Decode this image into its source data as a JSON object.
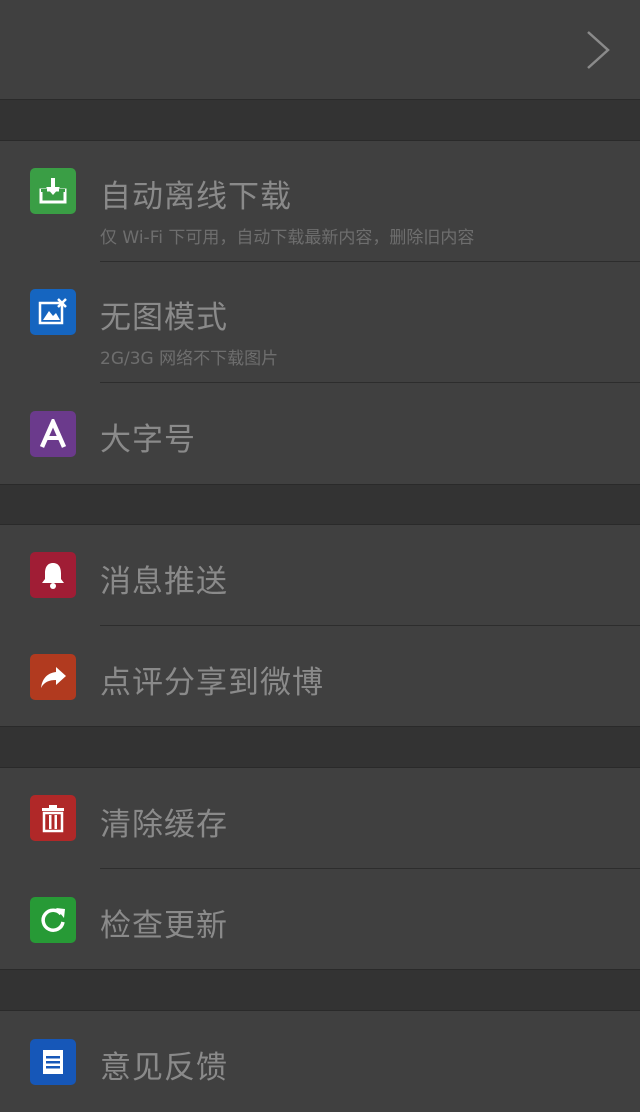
{
  "header": {
    "chevron_icon": "chevron-right-icon"
  },
  "colors": {
    "background": "#333333",
    "panel": "#404040",
    "label_text": "#8a8a8a",
    "sub_text": "#6e6e6e"
  },
  "groups": [
    {
      "items": [
        {
          "label": "自动离线下载",
          "sub": "仅 Wi-Fi 下可用，自动下载最新内容，删除旧内容",
          "icon": "download-icon",
          "color": "#3a9e45"
        },
        {
          "label": "无图模式",
          "sub": "2G/3G 网络不下载图片",
          "icon": "no-image-icon",
          "color": "#1565c0"
        },
        {
          "label": "大字号",
          "icon": "font-size-icon",
          "color": "#6b3a8c"
        }
      ]
    },
    {
      "items": [
        {
          "label": "消息推送",
          "icon": "bell-icon",
          "color": "#a01d35"
        },
        {
          "label": "点评分享到微博",
          "icon": "share-icon",
          "color": "#b13a1f"
        }
      ]
    },
    {
      "items": [
        {
          "label": "清除缓存",
          "icon": "trash-icon",
          "color": "#b02828"
        },
        {
          "label": "检查更新",
          "icon": "refresh-icon",
          "color": "#279a36"
        }
      ]
    },
    {
      "items": [
        {
          "label": "意见反馈",
          "icon": "document-icon",
          "color": "#1657b8"
        }
      ]
    }
  ]
}
